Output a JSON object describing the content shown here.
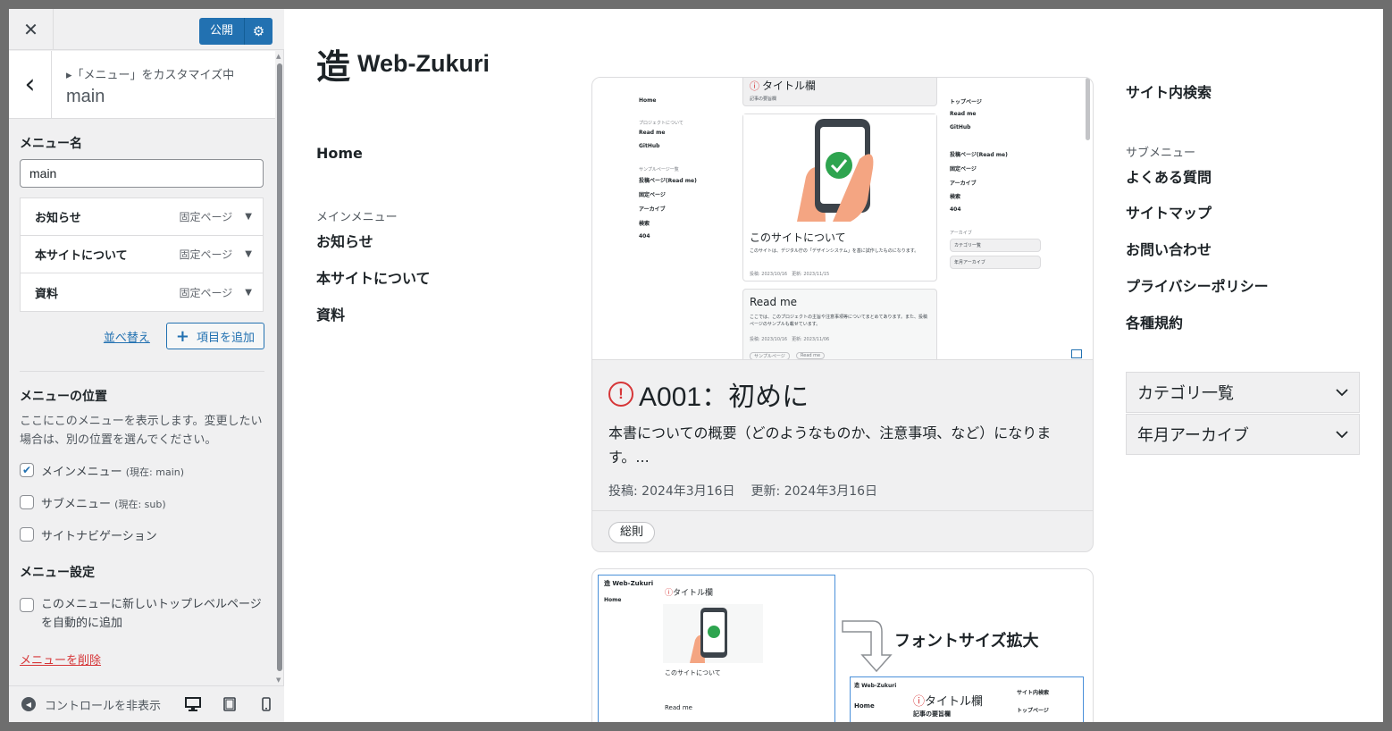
{
  "topbar": {
    "close_glyph": "✕",
    "publish_label": "公開",
    "gear_glyph": "⚙"
  },
  "section": {
    "back_glyph": "‹",
    "customizing": "▸「メニュー」をカスタマイズ中",
    "title": "main"
  },
  "menu_name": {
    "label": "メニュー名",
    "value": "main"
  },
  "menu_items": [
    {
      "name": "お知らせ",
      "type": "固定ページ"
    },
    {
      "name": "本サイトについて",
      "type": "固定ページ"
    },
    {
      "name": "資料",
      "type": "固定ページ"
    }
  ],
  "actions": {
    "reorder": "並べ替え",
    "add": "項目を追加"
  },
  "locations": {
    "heading": "メニューの位置",
    "description": "ここにこのメニューを表示します。変更したい場合は、別の位置を選んでください。",
    "options": [
      {
        "label": "メインメニュー",
        "note": "(現在: main)",
        "checked": true
      },
      {
        "label": "サブメニュー",
        "note": "(現在: sub)",
        "checked": false
      },
      {
        "label": "サイトナビゲーション",
        "note": "",
        "checked": false
      }
    ]
  },
  "settings": {
    "heading": "メニュー設定",
    "auto_add": "このメニューに新しいトップレベルページを自動的に追加"
  },
  "delete_link": "メニューを削除",
  "footer": {
    "hide_controls": "コントロールを非表示"
  },
  "site": {
    "logo_mark": "造",
    "logo_text": "Web-Zukuri",
    "nav_home": "Home",
    "nav_main_label": "メインメニュー",
    "nav_items": [
      "お知らせ",
      "本サイトについて",
      "資料"
    ]
  },
  "post": {
    "title": "A001：初めに",
    "excerpt": "本書についての概要（どのようなものか、注意事項、など）になります。...",
    "posted": "投稿: 2024年3月16日",
    "updated": "更新: 2024年3月16日",
    "tag": "総則",
    "image": {
      "title": "タイトル欄",
      "subtitle": "記事の要旨欄",
      "about_title": "このサイトについて",
      "about_text": "このサイトは、デジタル庁の「デザインシステム」を基に試作したものになります。",
      "about_meta": "投稿: 2023/10/16　更新: 2023/11/15",
      "readme_title": "Read me",
      "readme_text": "ここでは、このプロジェクトの主旨や注意事項等についてまとめてあります。また、投稿ページのサンプルも載せています。",
      "readme_meta": "投稿: 2023/10/16　更新: 2023/11/06",
      "left_menu": [
        "Home",
        "プロジェクトについて",
        "Read me",
        "GitHub",
        "サンプルページ一覧",
        "投稿ページ(Read me)",
        "固定ページ",
        "アーカイブ",
        "検索",
        "404"
      ],
      "right_menu": [
        "トップページ",
        "Read me",
        "GitHub",
        "投稿ページ(Read me)",
        "固定ページ",
        "アーカイブ",
        "検索",
        "404"
      ],
      "right_archive": "アーカイブ",
      "right_dd1": "カテゴリ一覧",
      "right_dd2": "年月アーカイブ",
      "tags": [
        "サンプルページ",
        "Read me"
      ]
    }
  },
  "post2": {
    "caption": "フォントサイズ拡大",
    "mini_logo": "造 Web-Zukuri",
    "mini_title": "タイトル欄",
    "mini_sub": "記事の要旨欄",
    "mini_about": "このサイトについて",
    "mini_readme": "Read me",
    "mini_home": "Home",
    "mini_search": "サイト内検索",
    "mini_top": "トップページ"
  },
  "right": {
    "search_heading": "サイト内検索",
    "sub_label": "サブメニュー",
    "sub_items": [
      "よくある質問",
      "サイトマップ",
      "お問い合わせ",
      "プライバシーポリシー",
      "各種規約"
    ],
    "dropdowns": [
      "カテゴリ一覧",
      "年月アーカイブ"
    ]
  },
  "colors": {
    "accent": "#2271b1",
    "danger": "#d63638",
    "panel_bg": "#f0f0f1"
  }
}
